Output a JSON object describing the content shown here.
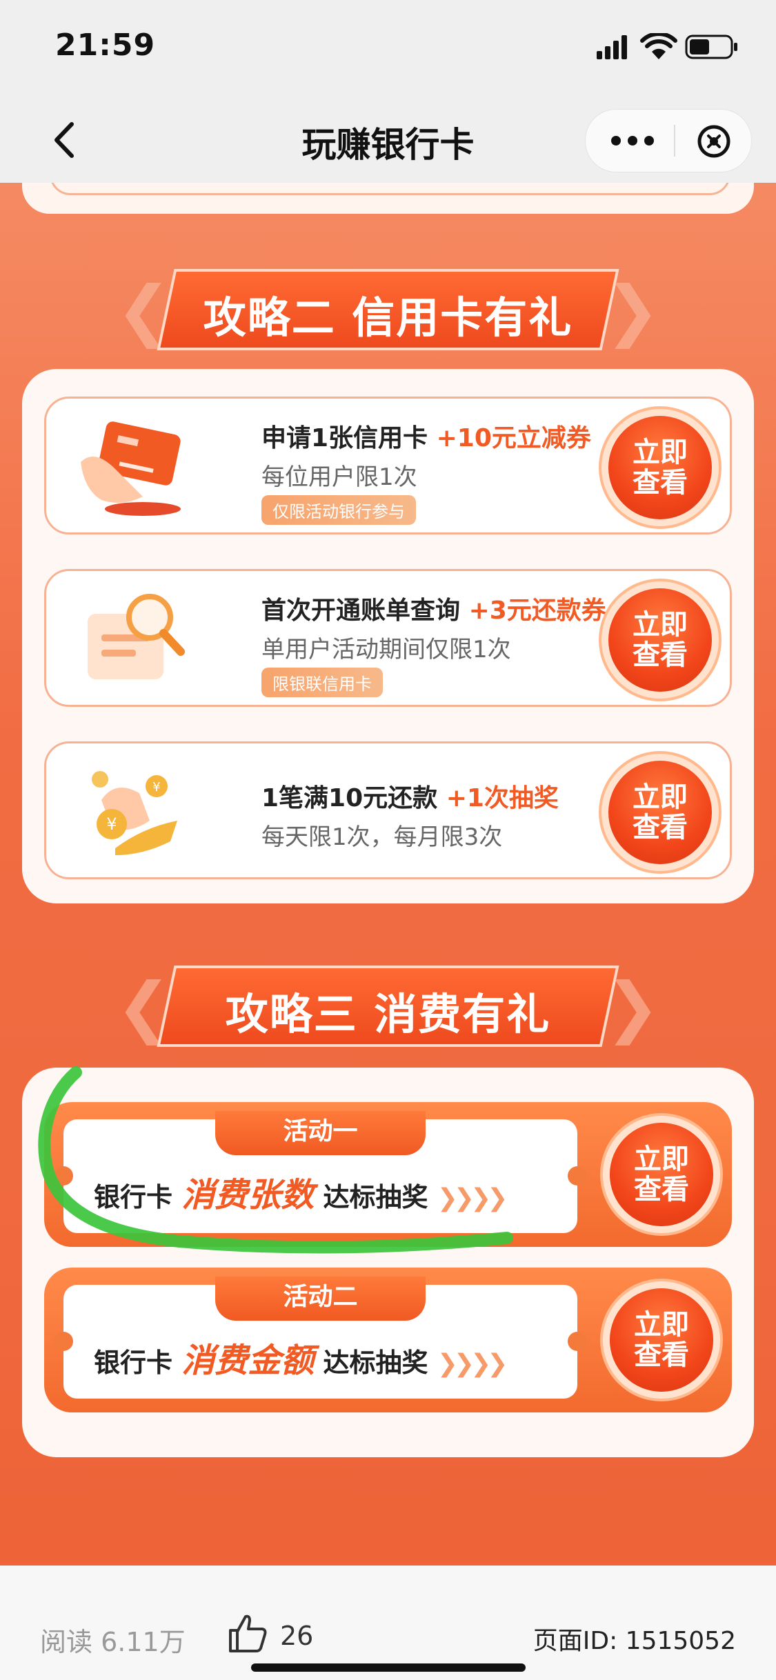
{
  "status_bar": {
    "time": "21:59"
  },
  "nav": {
    "title": "玩赚银行卡"
  },
  "section2": {
    "title": "攻略二 信用卡有礼",
    "cards": [
      {
        "title": "申请1张信用卡",
        "highlight": "+10元立减券",
        "sub": "每位用户限1次",
        "tag": "仅限活动银行参与",
        "icon": "credit-card-hand-icon",
        "button": [
          "立即",
          "查看"
        ]
      },
      {
        "title": "首次开通账单查询",
        "highlight": "+3元还款券",
        "sub": "单用户活动期间仅限1次",
        "tag": "限银联信用卡",
        "icon": "magnifier-bill-icon",
        "button": [
          "立即",
          "查看"
        ]
      },
      {
        "title": "1笔满10元还款",
        "highlight": "+1次抽奖",
        "sub": "每天限1次，每月限3次",
        "tag": "",
        "icon": "coins-hand-icon",
        "button": [
          "立即",
          "查看"
        ]
      }
    ]
  },
  "section3": {
    "title": "攻略三 消费有礼",
    "activities": [
      {
        "label": "活动一",
        "prefix": "银行卡",
        "emphasis": "消费张数",
        "suffix": "达标抽奖",
        "arrows": "❯❯❯❯",
        "button": [
          "立即",
          "查看"
        ]
      },
      {
        "label": "活动二",
        "prefix": "银行卡",
        "emphasis": "消费金额",
        "suffix": "达标抽奖",
        "arrows": "❯❯❯❯",
        "button": [
          "立即",
          "查看"
        ]
      }
    ]
  },
  "bottom": {
    "read": "阅读 6.11万",
    "likes": "26",
    "page_id": "页面ID: 1515052"
  },
  "colors": {
    "accent": "#f25a24",
    "bg_orange": "#f26c43",
    "annotation_green": "#3cc43c"
  }
}
